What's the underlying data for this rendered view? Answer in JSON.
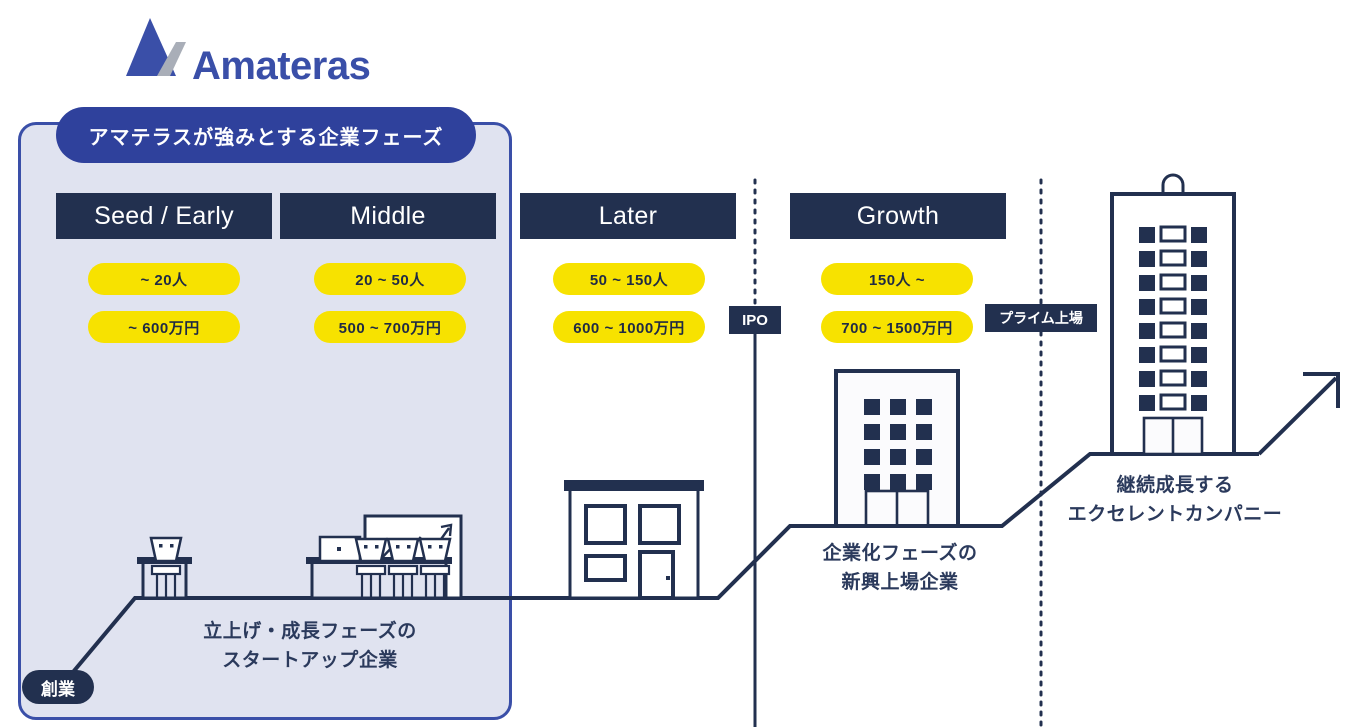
{
  "brand": {
    "name": "Amateras",
    "logo_mark": "triangle-logo-icon",
    "mark_color": "#3A4FA8",
    "mark_accent_color": "#A9AEB8",
    "text_color": "#3A4FA8"
  },
  "panel": {
    "badge_label": "アマテラスが強みとする企業フェーズ",
    "badge_bg": "#2F419C",
    "panel_bg": "#E0E3F0",
    "panel_border": "#3A4FA8"
  },
  "phases": [
    {
      "id": "seed-early",
      "title": "Seed / Early",
      "headcount": "~ 20人",
      "salary": "~ 600万円",
      "inside_panel": true
    },
    {
      "id": "middle",
      "title": "Middle",
      "headcount": "20 ~ 50人",
      "salary": "500 ~ 700万円",
      "inside_panel": true
    },
    {
      "id": "later",
      "title": "Later",
      "headcount": "50 ~ 150人",
      "salary": "600 ~ 1000万円",
      "inside_panel": false
    },
    {
      "id": "growth",
      "title": "Growth",
      "headcount": "150人 ~",
      "salary": "700 ~ 1500万円",
      "inside_panel": false
    }
  ],
  "milestones": {
    "founding": "創業",
    "ipo": "IPO",
    "prime_listing": "プライム上場"
  },
  "captions": {
    "startup": "立上げ・成長フェーズの\nスタートアップ企業",
    "startup_line1": "立上げ・成長フェーズの",
    "startup_line2": "スタートアップ企業",
    "emerging_line1": "企業化フェーズの",
    "emerging_line2": "新興上場企業",
    "excellent_line1": "継続成長する",
    "excellent_line2": "エクセレントカンパニー"
  },
  "illustrations": [
    {
      "name": "single-desk-worker-icon",
      "phase": "seed-early"
    },
    {
      "name": "team-desks-whiteboard-icon",
      "phase": "middle"
    },
    {
      "name": "small-office-building-icon",
      "phase": "later"
    },
    {
      "name": "mid-rise-building-icon",
      "phase": "growth"
    },
    {
      "name": "high-rise-building-icon",
      "phase": "excellent"
    },
    {
      "name": "growth-arrow-icon",
      "phase": "excellent"
    }
  ],
  "colors": {
    "ink": "#22304F",
    "ink_soft": "#2B3A5C",
    "accent_blue": "#3A4FA8",
    "badge_blue": "#2F419C",
    "yellow": "#F7E200",
    "panel_bg": "#E0E3F0",
    "page_bg": "#FFFFFF"
  }
}
